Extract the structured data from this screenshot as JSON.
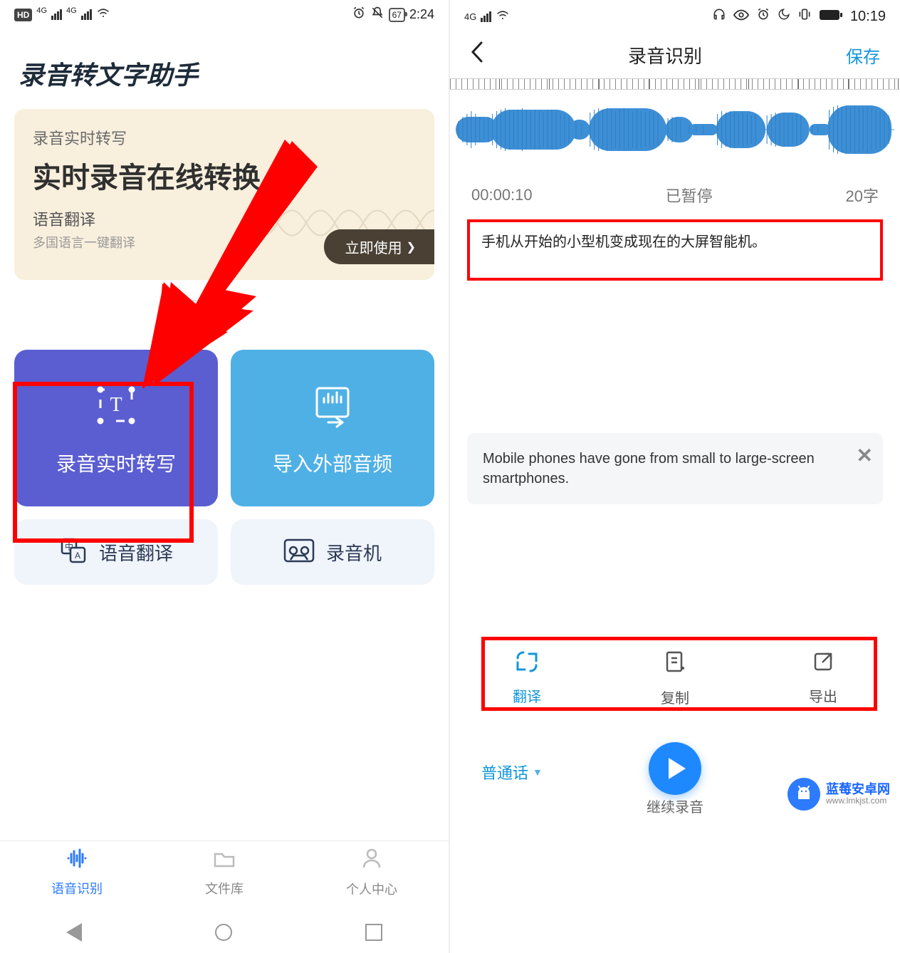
{
  "left": {
    "status": {
      "hd": "HD",
      "sig": "4G",
      "battery": "67",
      "time": "2:24"
    },
    "app_title": "录音转文字助手",
    "card": {
      "sub1": "录音实时转写",
      "h1": "实时录音在线转换",
      "sub2": "语音翻译",
      "sub3": "多国语言一键翻译",
      "btn": "立即使用"
    },
    "tiles": {
      "t1": "录音实时转写",
      "t2": "导入外部音频",
      "t3": "语音翻译",
      "t4": "录音机"
    },
    "nav": {
      "a": "语音识别",
      "b": "文件库",
      "c": "个人中心"
    }
  },
  "right": {
    "status": {
      "sig": "4G",
      "time": "10:19"
    },
    "nav": {
      "title": "录音识别",
      "save": "保存"
    },
    "rec": {
      "time": "00:00:10",
      "state": "已暂停",
      "count": "20字"
    },
    "transcript": "手机从开始的小型机变成现在的大屏智能机。",
    "translation": "Mobile phones have gone from small to large-screen smartphones.",
    "actions": {
      "translate": "翻译",
      "copy": "复制",
      "export": "导出"
    },
    "lang": "普通话",
    "continue_label": "继续录音",
    "watermark": {
      "line1": "蓝莓安卓网",
      "line2": "www.lmkjst.com"
    }
  }
}
